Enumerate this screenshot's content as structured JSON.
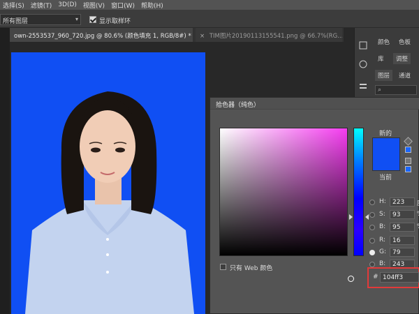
{
  "menu": [
    "选择(S)",
    "滤镜(T)",
    "3D(D)",
    "视图(V)",
    "窗口(W)",
    "帮助(H)"
  ],
  "options": {
    "layer_select": "所有图层",
    "show_ring_label": "显示取样环"
  },
  "doc_tabs": {
    "active": "own-2553537_960_720.jpg @ 80.6% (颜色填充 1, RGB/8#) *",
    "inactive": "TIM图片20190113155541.png @ 66.7%(RG..."
  },
  "right_panel": {
    "tab_color": "颜色",
    "tab_swatches": "色板",
    "tab_lib": "库",
    "tab_adjust": "调整",
    "tab_layers": "图层",
    "tab_channels": "通道"
  },
  "color_picker": {
    "title": "拾色器（纯色）",
    "new_label": "新的",
    "current_label": "当前",
    "web_only_label": "只有 Web 颜色",
    "h": {
      "label": "H:",
      "value": "223",
      "unit": "度"
    },
    "s": {
      "label": "S:",
      "value": "93",
      "unit": "%"
    },
    "b": {
      "label": "B:",
      "value": "95",
      "unit": "%"
    },
    "r": {
      "label": "R:",
      "value": "16"
    },
    "g": {
      "label": "G:",
      "value": "79"
    },
    "bb": {
      "label": "B:",
      "value": "243"
    },
    "hex_hash": "#",
    "hex": "104ff3"
  },
  "colors": {
    "selected": "#104ff3",
    "highlight": "#e23a3a"
  }
}
